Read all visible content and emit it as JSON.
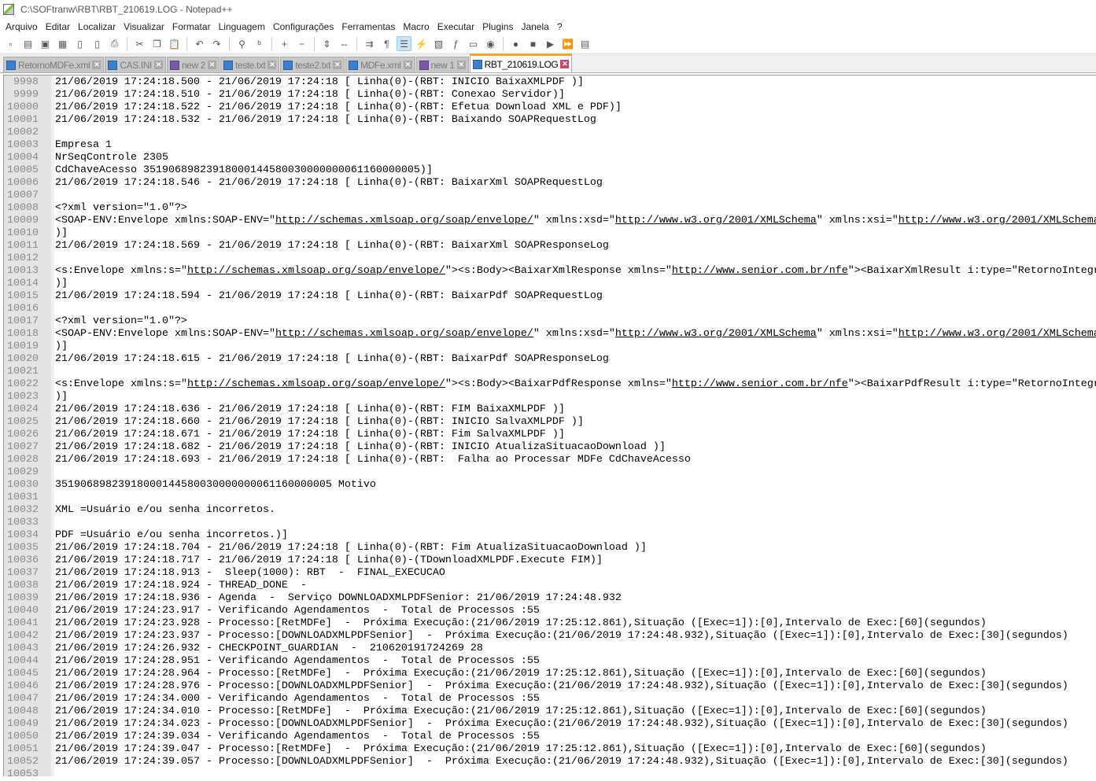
{
  "window": {
    "title": "C:\\SOFtranw\\RBT\\RBT_210619.LOG - Notepad++"
  },
  "menu": [
    "Arquivo",
    "Editar",
    "Localizar",
    "Visualizar",
    "Formatar",
    "Linguagem",
    "Configurações",
    "Ferramentas",
    "Macro",
    "Executar",
    "Plugins",
    "Janela",
    "?"
  ],
  "toolbar": [
    {
      "icon": "new-file-icon",
      "g": "▫"
    },
    {
      "icon": "open-file-icon",
      "g": "▤"
    },
    {
      "icon": "save-icon",
      "g": "▣"
    },
    {
      "icon": "save-all-icon",
      "g": "▦"
    },
    {
      "icon": "close-icon",
      "g": "▯"
    },
    {
      "icon": "close-all-icon",
      "g": "▯"
    },
    {
      "icon": "print-icon",
      "g": "⎙"
    },
    "|",
    {
      "icon": "cut-icon",
      "g": "✂"
    },
    {
      "icon": "copy-icon",
      "g": "❐"
    },
    {
      "icon": "paste-icon",
      "g": "📋"
    },
    "|",
    {
      "icon": "undo-icon",
      "g": "↶"
    },
    {
      "icon": "redo-icon",
      "g": "↷"
    },
    "|",
    {
      "icon": "find-icon",
      "g": "⚲"
    },
    {
      "icon": "replace-icon",
      "g": "ᵇ"
    },
    "|",
    {
      "icon": "zoom-in-icon",
      "g": "+"
    },
    {
      "icon": "zoom-out-icon",
      "g": "−"
    },
    "|",
    {
      "icon": "sync-vertical-icon",
      "g": "⇕"
    },
    {
      "icon": "sync-horizontal-icon",
      "g": "⇔"
    },
    "|",
    {
      "icon": "word-wrap-icon",
      "g": "⇉"
    },
    {
      "icon": "show-all-chars-icon",
      "g": "¶"
    },
    {
      "icon": "indent-guide-icon",
      "g": "☰",
      "active": true
    },
    {
      "icon": "language-icon",
      "g": "⚡"
    },
    {
      "icon": "document-map-icon",
      "g": "▧"
    },
    {
      "icon": "function-list-icon",
      "g": "ƒ"
    },
    {
      "icon": "folder-workspace-icon",
      "g": "▭"
    },
    {
      "icon": "monitoring-icon",
      "g": "◉"
    },
    "|",
    {
      "icon": "record-macro-icon",
      "g": "●"
    },
    {
      "icon": "stop-macro-icon",
      "g": "■"
    },
    {
      "icon": "play-macro-icon",
      "g": "▶"
    },
    {
      "icon": "run-macro-multiple-icon",
      "g": "⏩"
    },
    {
      "icon": "save-macro-icon",
      "g": "▤"
    }
  ],
  "tabs": [
    {
      "label": "RetornoMDFe.xml",
      "color": "blue"
    },
    {
      "label": "CAS.INI",
      "color": "blue"
    },
    {
      "label": "new 2",
      "color": "purple"
    },
    {
      "label": "teste.txt",
      "color": "blue"
    },
    {
      "label": "teste2.txt",
      "color": "blue"
    },
    {
      "label": "MDFe.xml",
      "color": "blue"
    },
    {
      "label": "new 1",
      "color": "purple"
    },
    {
      "label": "RBT_210619.LOG",
      "color": "blue",
      "active": true
    }
  ],
  "editor": {
    "first_line": 9998,
    "lines": [
      "21/06/2019 17:24:18.500 - 21/06/2019 17:24:18 [ Linha(0)-(RBT: INICIO BaixaXMLPDF )]",
      "21/06/2019 17:24:18.510 - 21/06/2019 17:24:18 [ Linha(0)-(RBT: Conexao Servidor)]",
      "21/06/2019 17:24:18.522 - 21/06/2019 17:24:18 [ Linha(0)-(RBT: Efetua Download XML e PDF)]",
      "21/06/2019 17:24:18.532 - 21/06/2019 17:24:18 [ Linha(0)-(RBT: Baixando SOAPRequestLog",
      "",
      "Empresa 1",
      "NrSeqControle 2305",
      "CdChaveAcesso 35190689823918000144580030000000061160000005)]",
      "21/06/2019 17:24:18.546 - 21/06/2019 17:24:18 [ Linha(0)-(RBT: BaixarXml SOAPRequestLog",
      "",
      "<?xml version=\"1.0\"?>",
      "<SOAP-ENV:Envelope xmlns:SOAP-ENV=\"http://schemas.xmlsoap.org/soap/envelope/\" xmlns:xsd=\"http://www.w3.org/2001/XMLSchema\" xmlns:xsi=\"http://www.w3.org/2001/XMLSchema",
      ")]",
      "21/06/2019 17:24:18.569 - 21/06/2019 17:24:18 [ Linha(0)-(RBT: BaixarXml SOAPResponseLog",
      "",
      "<s:Envelope xmlns:s=\"http://schemas.xmlsoap.org/soap/envelope/\"><s:Body><BaixarXmlResponse xmlns=\"http://www.senior.com.br/nfe\"><BaixarXmlResult i:type=\"RetornoIntegr",
      ")]",
      "21/06/2019 17:24:18.594 - 21/06/2019 17:24:18 [ Linha(0)-(RBT: BaixarPdf SOAPRequestLog",
      "",
      "<?xml version=\"1.0\"?>",
      "<SOAP-ENV:Envelope xmlns:SOAP-ENV=\"http://schemas.xmlsoap.org/soap/envelope/\" xmlns:xsd=\"http://www.w3.org/2001/XMLSchema\" xmlns:xsi=\"http://www.w3.org/2001/XMLSchema",
      ")]",
      "21/06/2019 17:24:18.615 - 21/06/2019 17:24:18 [ Linha(0)-(RBT: BaixarPdf SOAPResponseLog",
      "",
      "<s:Envelope xmlns:s=\"http://schemas.xmlsoap.org/soap/envelope/\"><s:Body><BaixarPdfResponse xmlns=\"http://www.senior.com.br/nfe\"><BaixarPdfResult i:type=\"RetornoIntegr",
      ")]",
      "21/06/2019 17:24:18.636 - 21/06/2019 17:24:18 [ Linha(0)-(RBT: FIM BaixaXMLPDF )]",
      "21/06/2019 17:24:18.660 - 21/06/2019 17:24:18 [ Linha(0)-(RBT: INICIO SalvaXMLPDF )]",
      "21/06/2019 17:24:18.671 - 21/06/2019 17:24:18 [ Linha(0)-(RBT: Fim SalvaXMLPDF )]",
      "21/06/2019 17:24:18.682 - 21/06/2019 17:24:18 [ Linha(0)-(RBT: INICIO AtualizaSituacaoDownload )]",
      "21/06/2019 17:24:18.693 - 21/06/2019 17:24:18 [ Linha(0)-(RBT:  Falha ao Processar MDFe CdChaveAcesso",
      "",
      "35190689823918000144580030000000061160000005 Motivo",
      "",
      "XML =Usuário e/ou senha incorretos.",
      "",
      "PDF =Usuário e/ou senha incorretos.)]",
      "21/06/2019 17:24:18.704 - 21/06/2019 17:24:18 [ Linha(0)-(RBT: Fim AtualizaSituacaoDownload )]",
      "21/06/2019 17:24:18.717 - 21/06/2019 17:24:18 [ Linha(0)-(TDownloadXMLPDF.Execute FIM)]",
      "21/06/2019 17:24:18.913 -  Sleep(1000): RBT  -  FINAL_EXECUCAO",
      "21/06/2019 17:24:18.924 - THREAD_DONE  -",
      "21/06/2019 17:24:18.936 - Agenda  -  Serviço DOWNLOADXMLPDFSenior: 21/06/2019 17:24:48.932",
      "21/06/2019 17:24:23.917 - Verificando Agendamentos  -  Total de Processos :55",
      "21/06/2019 17:24:23.928 - Processo:[RetMDFe]  -  Próxima Execução:(21/06/2019 17:25:12.861),Situação ([Exec=1]):[0],Intervalo de Exec:[60](segundos)",
      "21/06/2019 17:24:23.937 - Processo:[DOWNLOADXMLPDFSenior]  -  Próxima Execução:(21/06/2019 17:24:48.932),Situação ([Exec=1]):[0],Intervalo de Exec:[30](segundos)",
      "21/06/2019 17:24:26.932 - CHECKPOINT_GUARDIAN  -  210620191724269 28",
      "21/06/2019 17:24:28.951 - Verificando Agendamentos  -  Total de Processos :55",
      "21/06/2019 17:24:28.964 - Processo:[RetMDFe]  -  Próxima Execução:(21/06/2019 17:25:12.861),Situação ([Exec=1]):[0],Intervalo de Exec:[60](segundos)",
      "21/06/2019 17:24:28.976 - Processo:[DOWNLOADXMLPDFSenior]  -  Próxima Execução:(21/06/2019 17:24:48.932),Situação ([Exec=1]):[0],Intervalo de Exec:[30](segundos)",
      "21/06/2019 17:24:34.000 - Verificando Agendamentos  -  Total de Processos :55",
      "21/06/2019 17:24:34.010 - Processo:[RetMDFe]  -  Próxima Execução:(21/06/2019 17:25:12.861),Situação ([Exec=1]):[0],Intervalo de Exec:[60](segundos)",
      "21/06/2019 17:24:34.023 - Processo:[DOWNLOADXMLPDFSenior]  -  Próxima Execução:(21/06/2019 17:24:48.932),Situação ([Exec=1]):[0],Intervalo de Exec:[30](segundos)",
      "21/06/2019 17:24:39.034 - Verificando Agendamentos  -  Total de Processos :55",
      "21/06/2019 17:24:39.047 - Processo:[RetMDFe]  -  Próxima Execução:(21/06/2019 17:25:12.861),Situação ([Exec=1]):[0],Intervalo de Exec:[60](segundos)",
      "21/06/2019 17:24:39.057 - Processo:[DOWNLOADXMLPDFSenior]  -  Próxima Execução:(21/06/2019 17:24:48.932),Situação ([Exec=1]):[0],Intervalo de Exec:[30](segundos)",
      ""
    ]
  },
  "colors": {
    "active_tab_accent": "#f5a030",
    "gutter_bg": "#e4e4e4",
    "line_number": "#888888"
  }
}
